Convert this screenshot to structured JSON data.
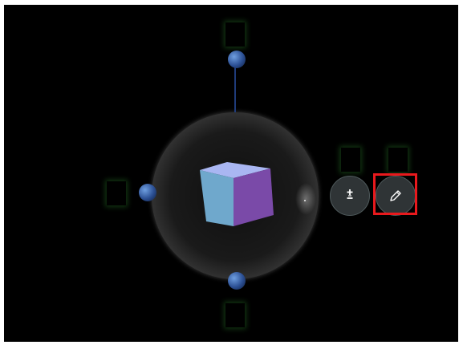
{
  "scene": {
    "background_color": "#000000",
    "cube_colors": {
      "top": "#a9b6f2",
      "left": "#6fa8cc",
      "right": "#7a4aa8"
    },
    "orbit_ball_color": "#2b4f93",
    "slot_glow_color": "#287828"
  },
  "toolbar": {
    "scale_button_icon": "plus-minus-icon",
    "edit_button_icon": "pencil-icon",
    "highlight_color": "#e8191d",
    "button_color": "#2f3436"
  }
}
